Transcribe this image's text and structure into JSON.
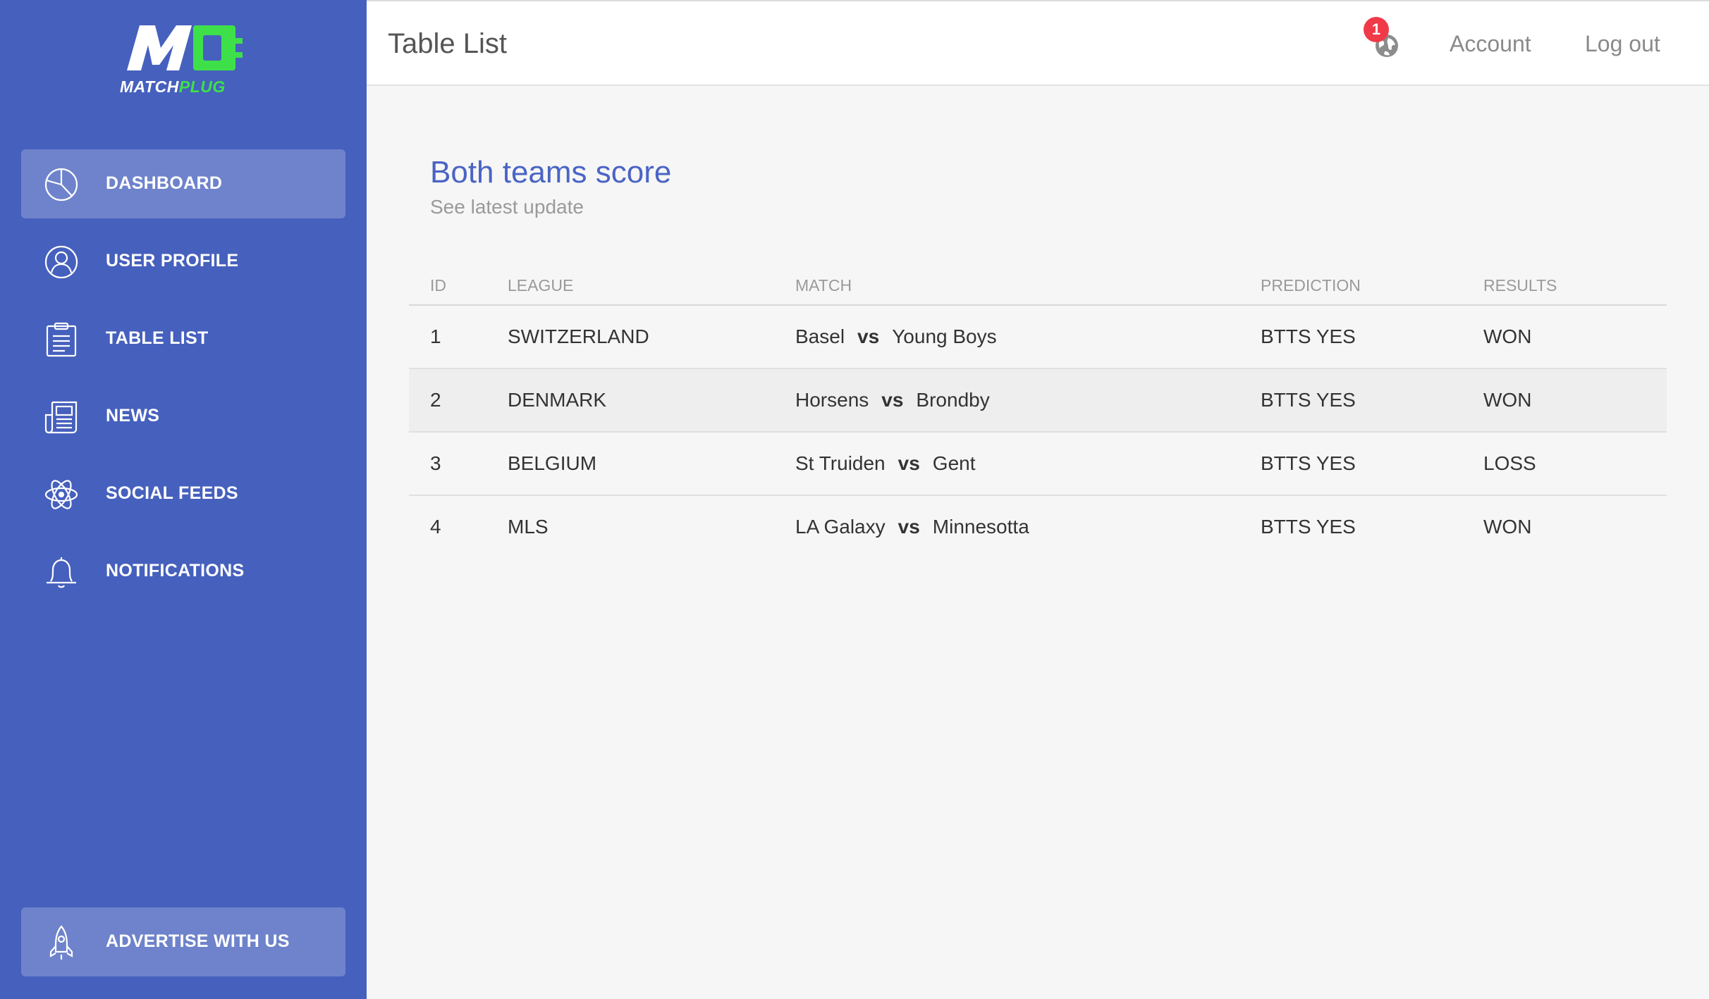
{
  "brand": {
    "logo_text_white": "MATCH",
    "logo_text_green": "PLUG",
    "colors": {
      "sidebar": "#4660bd",
      "accent_green": "#3ee04a",
      "title_blue": "#4a64c4",
      "badge_red": "#f03a47"
    }
  },
  "sidebar": {
    "items": [
      {
        "label": "DASHBOARD",
        "icon": "pie-chart-icon",
        "active": true
      },
      {
        "label": "USER PROFILE",
        "icon": "user-icon",
        "active": false
      },
      {
        "label": "TABLE LIST",
        "icon": "clipboard-icon",
        "active": false
      },
      {
        "label": "NEWS",
        "icon": "newspaper-icon",
        "active": false
      },
      {
        "label": "SOCIAL FEEDS",
        "icon": "atom-icon",
        "active": false
      },
      {
        "label": "NOTIFICATIONS",
        "icon": "bell-icon",
        "active": false
      }
    ],
    "bottom_item": {
      "label": "ADVERTISE WITH US",
      "icon": "rocket-icon"
    }
  },
  "header": {
    "title": "Table List",
    "notification_count": "1",
    "account_label": "Account",
    "logout_label": "Log out"
  },
  "card": {
    "title": "Both teams score",
    "subtitle": "See latest update"
  },
  "table": {
    "columns": [
      "ID",
      "LEAGUE",
      "MATCH",
      "PREDICTION",
      "RESULTS"
    ],
    "vs_label": "vs",
    "rows": [
      {
        "id": "1",
        "league": "SWITZERLAND",
        "home": "Basel",
        "away": "Young Boys",
        "prediction": "BTTS YES",
        "result": "WON"
      },
      {
        "id": "2",
        "league": "DENMARK",
        "home": "Horsens",
        "away": "Brondby",
        "prediction": "BTTS YES",
        "result": "WON"
      },
      {
        "id": "3",
        "league": "BELGIUM",
        "home": "St Truiden",
        "away": "Gent",
        "prediction": "BTTS YES",
        "result": "LOSS"
      },
      {
        "id": "4",
        "league": "MLS",
        "home": "LA Galaxy",
        "away": "Minnesotta",
        "prediction": "BTTS YES",
        "result": "WON"
      }
    ]
  }
}
